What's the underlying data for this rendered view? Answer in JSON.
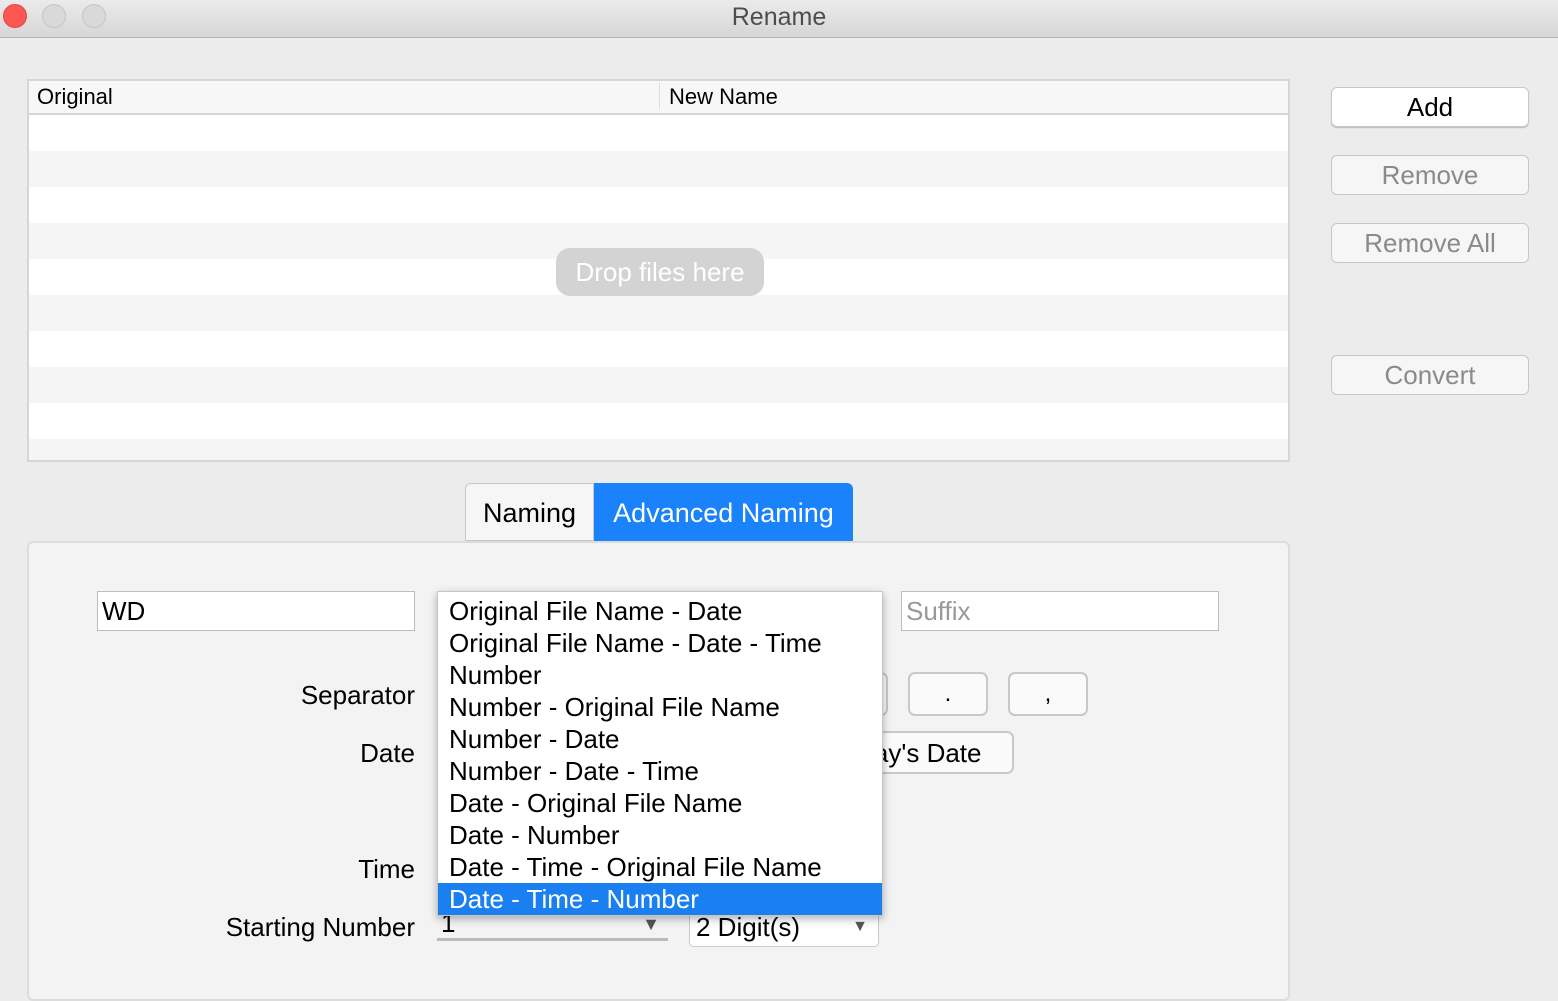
{
  "window": {
    "title": "Rename"
  },
  "table": {
    "columns": [
      "Original",
      "New Name"
    ],
    "drop_hint": "Drop files here"
  },
  "actions": {
    "add": "Add",
    "remove": "Remove",
    "remove_all": "Remove All",
    "convert": "Convert"
  },
  "tabs": [
    {
      "label": "Naming",
      "selected": false
    },
    {
      "label": "Advanced Naming",
      "selected": true
    }
  ],
  "form": {
    "prefix_value": "WD",
    "suffix_placeholder": "Suffix",
    "separator_label": "Separator",
    "separator_buttons": [
      ".",
      ","
    ],
    "date_label": "Date",
    "date_button": "Today's Date",
    "time_label": "Time",
    "starting_number_label": "Starting Number",
    "starting_number_value": "1",
    "digits_value": "2 Digit(s)"
  },
  "format_popup": {
    "options": [
      "Original File Name - Date",
      "Original File Name - Date - Time",
      "Number",
      "Number - Original File Name",
      "Number - Date",
      "Number - Date - Time",
      "Date - Original File Name",
      "Date - Number",
      "Date - Time - Original File Name",
      "Date - Time - Number"
    ],
    "selected": "Date - Time - Number"
  },
  "colors": {
    "accent": "#1a82fb",
    "close": "#fc5753"
  }
}
